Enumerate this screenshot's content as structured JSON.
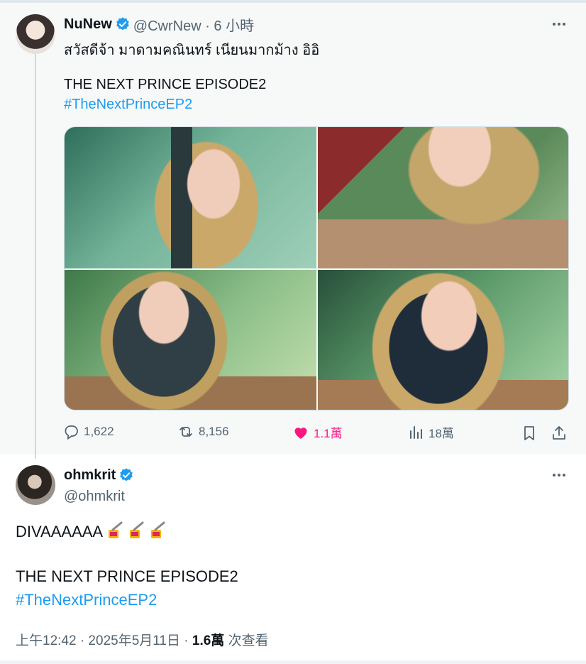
{
  "tweet1": {
    "name": "NuNew",
    "handle": "@CwrNew · 6 小時",
    "line1": "สวัสดีจ้า มาดามคณินทร์ เนียนมากม้าง อิอิ",
    "line2": "THE NEXT PRINCE EPISODE2",
    "hashtag": "#TheNextPrinceEP2",
    "stats": {
      "replies": "1,622",
      "reposts": "8,156",
      "likes": "1.1萬",
      "views": "18萬"
    }
  },
  "tweet2": {
    "name": "ohmkrit",
    "handle": "@ohmkrit",
    "line1": "DIVAAAAAA",
    "emoji_name": "nail-polish-emoji",
    "line2": "THE NEXT PRINCE EPISODE2",
    "hashtag": "#TheNextPrinceEP2",
    "time": "上午12:42 · 2025年5月11日 · ",
    "views_count": "1.6萬",
    "views_label": " 次查看"
  },
  "colors": {
    "accent": "#1d9bf0",
    "like": "#f91880",
    "muted": "#536471",
    "text": "#0f1419"
  }
}
